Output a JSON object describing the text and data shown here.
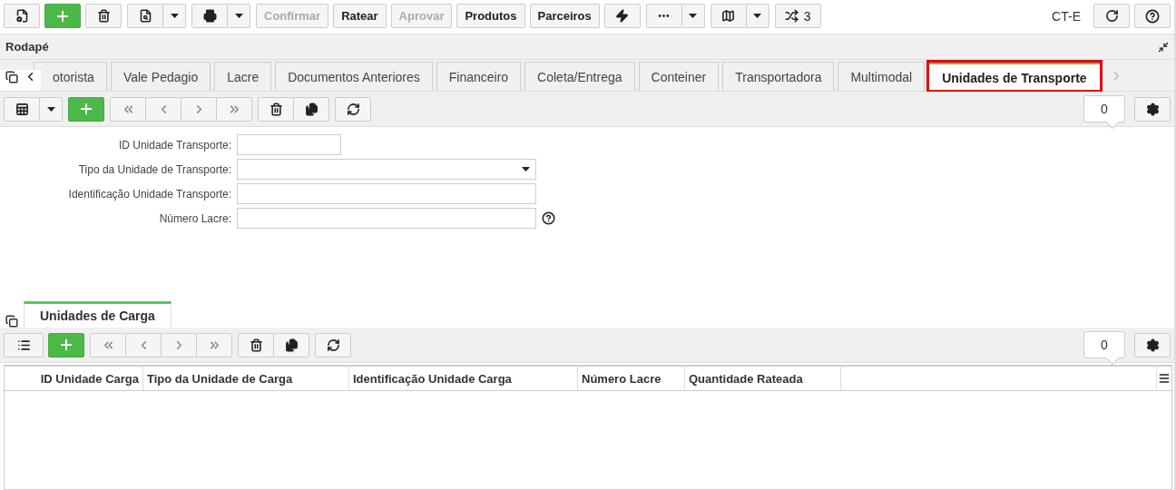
{
  "toolbar": {
    "actions": [
      {
        "label": "Confirmar",
        "disabled": true
      },
      {
        "label": "Ratear",
        "disabled": false
      },
      {
        "label": "Aprovar",
        "disabled": true
      },
      {
        "label": "Produtos",
        "disabled": false
      },
      {
        "label": "Parceiros",
        "disabled": false
      }
    ],
    "shuffle_count": "3",
    "module": "CT-E"
  },
  "panel": {
    "title": "Rodapé"
  },
  "tabs": [
    {
      "label": "otorista",
      "selected": false,
      "highlighted": false
    },
    {
      "label": "Vale Pedagio",
      "selected": false,
      "highlighted": false
    },
    {
      "label": "Lacre",
      "selected": false,
      "highlighted": false
    },
    {
      "label": "Documentos Anteriores",
      "selected": false,
      "highlighted": false
    },
    {
      "label": "Financeiro",
      "selected": false,
      "highlighted": false
    },
    {
      "label": "Coleta/Entrega",
      "selected": false,
      "highlighted": false
    },
    {
      "label": "Conteiner",
      "selected": false,
      "highlighted": false
    },
    {
      "label": "Transportadora",
      "selected": false,
      "highlighted": false
    },
    {
      "label": "Multimodal",
      "selected": false,
      "highlighted": false
    },
    {
      "label": "Unidades de Transporte",
      "selected": true,
      "highlighted": true
    }
  ],
  "form_toolbar": {
    "record_count": "0"
  },
  "form": {
    "fields": [
      {
        "label": "ID Unidade Transporte:",
        "kind": "short",
        "help": false
      },
      {
        "label": "Tipo da Unidade de Transporte:",
        "kind": "dropdown",
        "help": false
      },
      {
        "label": "Identificação Unidade Transporte:",
        "kind": "wide",
        "help": false
      },
      {
        "label": "Número Lacre:",
        "kind": "wide",
        "help": true
      }
    ]
  },
  "subtabs": [
    {
      "label": "Unidades de Carga",
      "selected": true
    }
  ],
  "grid_toolbar": {
    "record_count": "0"
  },
  "table": {
    "columns": [
      "ID Unidade Carga",
      "Tipo da Unidade de Carga",
      "Identificação Unidade Carga",
      "Número Lacre",
      "Quantidade Rateada"
    ]
  }
}
